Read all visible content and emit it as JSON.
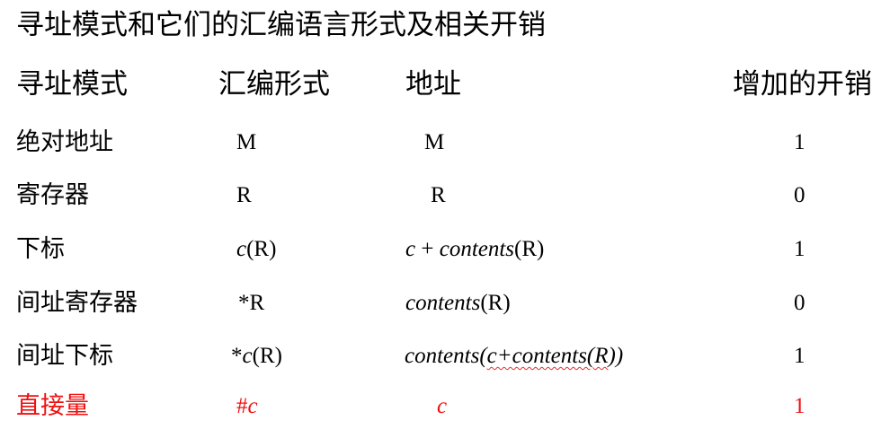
{
  "title": "寻址模式和它们的汇编语言形式及相关开销",
  "headers": {
    "mode": "寻址模式",
    "asm": "汇编形式",
    "addr": "地址",
    "cost": "增加的开销"
  },
  "rows": [
    {
      "mode": "绝对地址",
      "asm": [
        {
          "t": "M",
          "i": false
        }
      ],
      "addr": [
        {
          "t": "M",
          "i": false
        }
      ],
      "cost": "1"
    },
    {
      "mode": "寄存器",
      "asm": [
        {
          "t": "R",
          "i": false
        }
      ],
      "addr": [
        {
          "t": "R",
          "i": false
        }
      ],
      "cost": "0"
    },
    {
      "mode": "下标",
      "asm": [
        {
          "t": "c",
          "i": true
        },
        {
          "t": "(R)",
          "i": false
        }
      ],
      "addr": [
        {
          "t": "c",
          "i": true
        },
        {
          "t": " + ",
          "i": false
        },
        {
          "t": "contents",
          "i": true
        },
        {
          "t": "(R)",
          "i": false
        }
      ],
      "cost": "1"
    },
    {
      "mode": "间址寄存器",
      "asm": [
        {
          "t": "*R",
          "i": false
        }
      ],
      "addr": [
        {
          "t": "contents",
          "i": true
        },
        {
          "t": "(R)",
          "i": false
        }
      ],
      "cost": "0"
    },
    {
      "mode": "间址下标",
      "asm": [
        {
          "t": "*",
          "i": false
        },
        {
          "t": "c",
          "i": true
        },
        {
          "t": "(R)",
          "i": false
        }
      ],
      "addr": [
        {
          "t": "contents(",
          "i": true
        },
        {
          "t": "c+contents(R",
          "i": true,
          "wavy": true
        },
        {
          "t": "))",
          "i": true
        }
      ],
      "cost": "1"
    },
    {
      "mode": "直接量",
      "asm": [
        {
          "t": "#",
          "i": false
        },
        {
          "t": "c",
          "i": true
        }
      ],
      "addr": [
        {
          "t": "c",
          "i": true
        }
      ],
      "cost": "1",
      "highlight": true
    }
  ],
  "colors": {
    "text": "#000000",
    "highlight": "#ee1111",
    "squiggle": "#e03030"
  }
}
